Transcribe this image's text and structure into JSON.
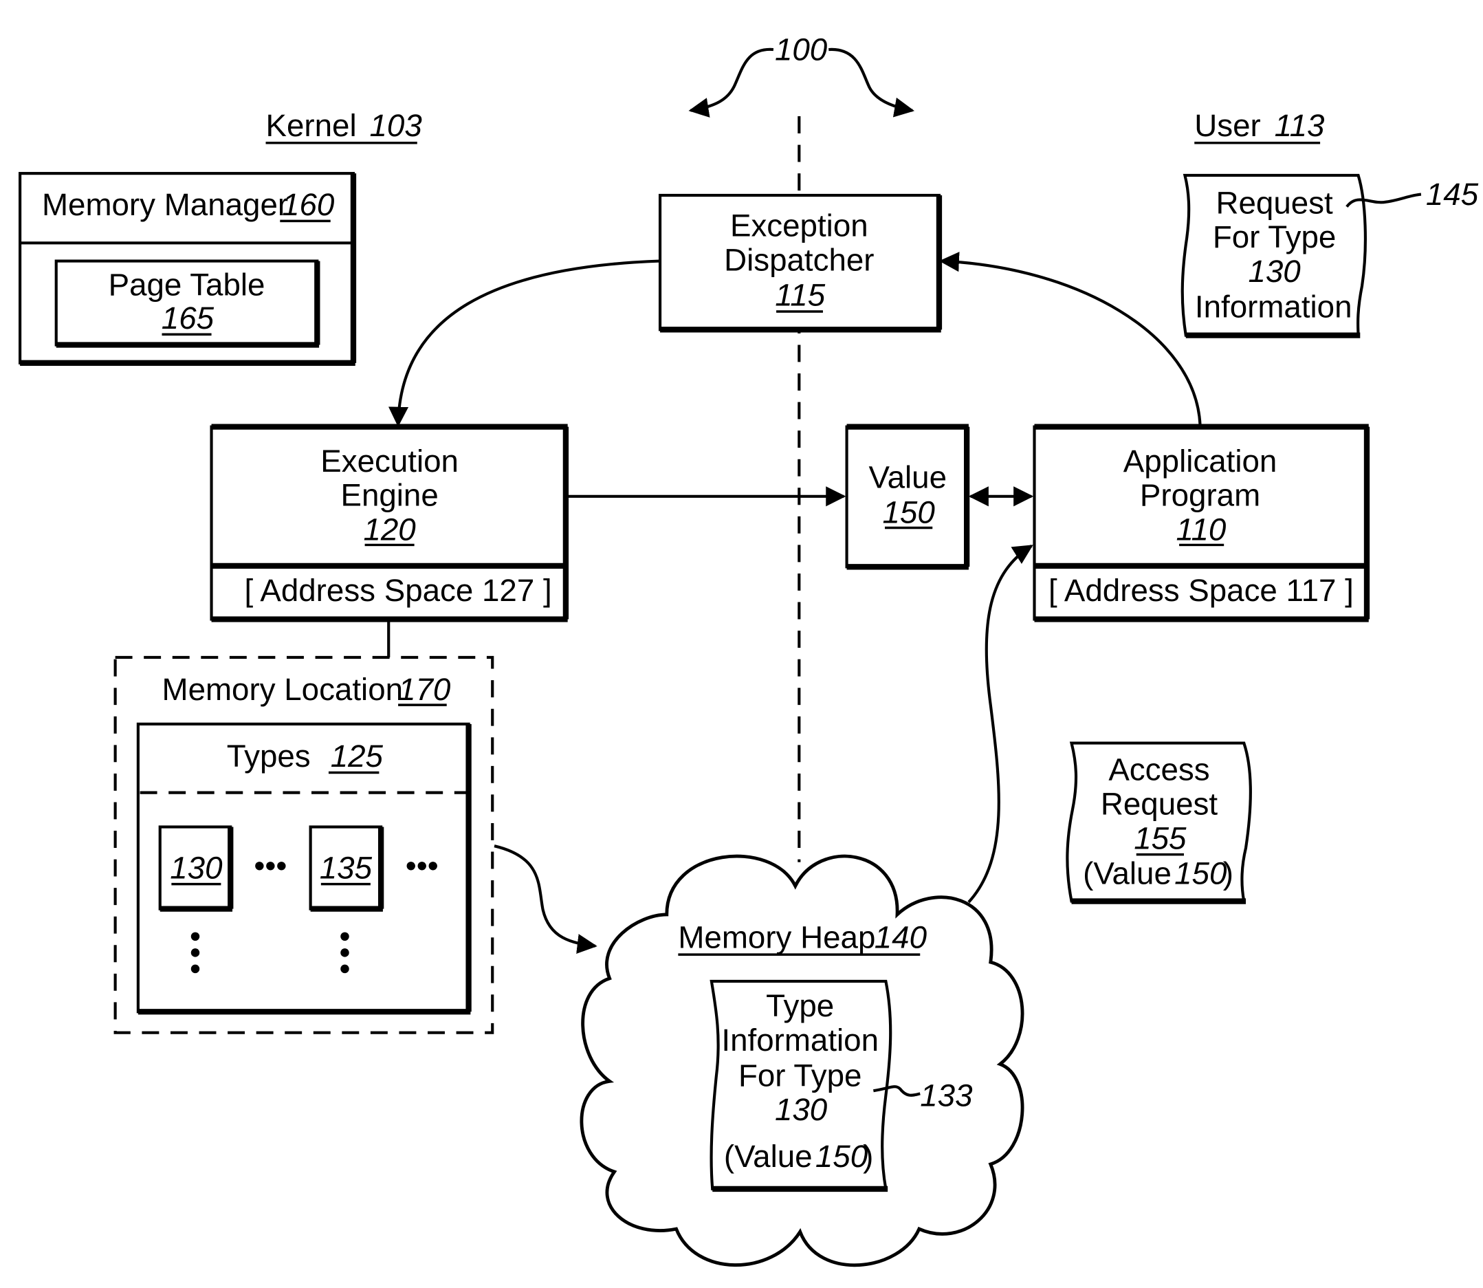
{
  "figure": {
    "ref": "100",
    "regions": {
      "kernel": {
        "label": "Kernel",
        "num": "103"
      },
      "user": {
        "label": "User",
        "num": "113"
      }
    }
  },
  "components": {
    "memory_manager": {
      "label": "Memory Manager",
      "num": "160"
    },
    "page_table": {
      "label": "Page Table",
      "num": "165"
    },
    "exception_dispatcher": {
      "line1": "Exception",
      "line2": "Dispatcher",
      "num": "115"
    },
    "execution_engine": {
      "line1": "Execution",
      "line2": "Engine",
      "num": "120",
      "address_space": "[ Address Space 127 ]"
    },
    "value": {
      "label": "Value",
      "num": "150"
    },
    "application_program": {
      "line1": "Application",
      "line2": "Program",
      "num": "110",
      "address_space": "[ Address Space 117 ]"
    },
    "request_doc": {
      "line1": "Request",
      "line2": "For Type",
      "line3": "130",
      "line4": "Information",
      "ref": "145"
    },
    "memory_location": {
      "label": "Memory Location",
      "num": "170"
    },
    "types": {
      "label": "Types",
      "num": "125",
      "items": [
        "130",
        "135"
      ],
      "ellipsis": "•••"
    },
    "memory_heap": {
      "label": "Memory Heap",
      "num": "140"
    },
    "type_info_doc": {
      "line1": "Type",
      "line2": "Information",
      "line3": "For Type",
      "line4": "130",
      "line5_label": "(Value",
      "line5_num": "150",
      "line5_close": ")",
      "ref": "133"
    },
    "access_request_doc": {
      "line1": "Access",
      "line2": "Request",
      "num": "155",
      "line4_label": "(Value",
      "line4_num": "150",
      "line4_close": ")"
    }
  }
}
